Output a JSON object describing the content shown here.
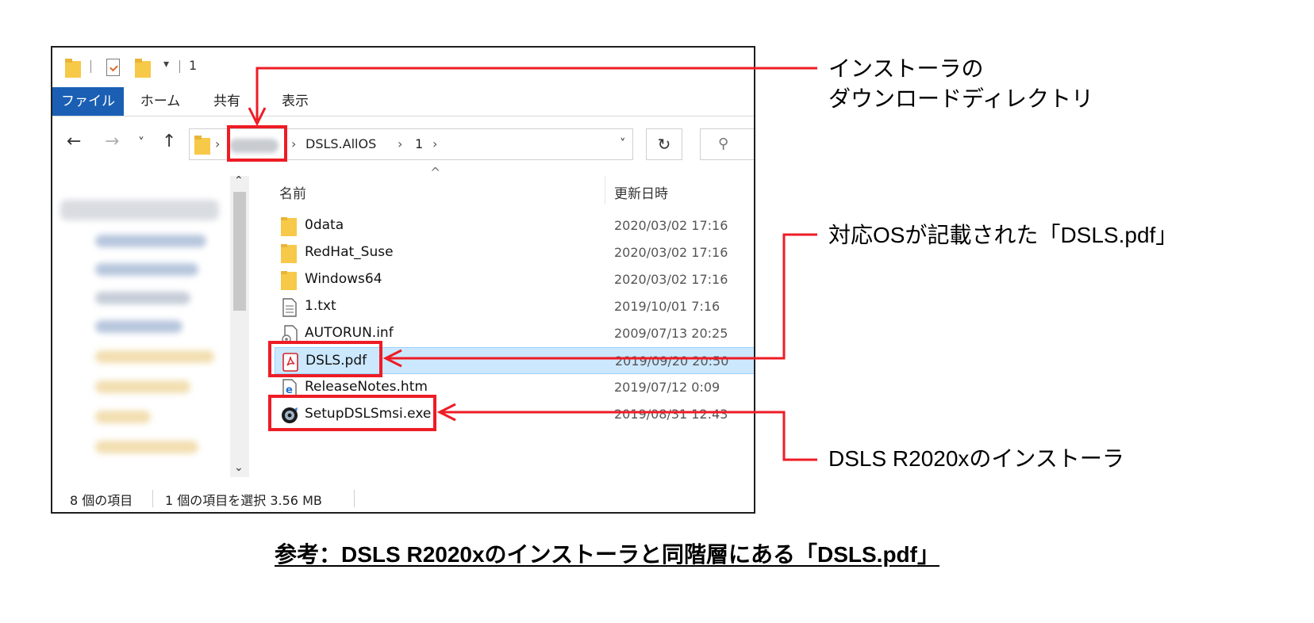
{
  "qat": {
    "title": "1",
    "dropdown": "▾"
  },
  "ribbon": {
    "tabs": [
      "ファイル",
      "ホーム",
      "共有",
      "表示"
    ]
  },
  "nav": {
    "back": "←",
    "forward": "→",
    "recent": "˅",
    "up": "↑"
  },
  "address": {
    "crumbs": [
      "DSLS.AllOS",
      "1"
    ],
    "separator": "›",
    "dropdown": "˅",
    "refresh": "↻",
    "search_icon": "⚲"
  },
  "columns": {
    "name": "名前",
    "date": "更新日時"
  },
  "files": [
    {
      "icon": "folder-icon",
      "name": "0data",
      "date": "2020/03/02 17:16"
    },
    {
      "icon": "folder-icon",
      "name": "RedHat_Suse",
      "date": "2020/03/02 17:16"
    },
    {
      "icon": "folder-icon",
      "name": "Windows64",
      "date": "2020/03/02 17:16"
    },
    {
      "icon": "text-file-icon",
      "name": "1.txt",
      "date": "2019/10/01 7:16"
    },
    {
      "icon": "settings-file-icon",
      "name": "AUTORUN.inf",
      "date": "2009/07/13 20:25"
    },
    {
      "icon": "pdf-icon",
      "name": "DSLS.pdf",
      "date": "2019/09/20 20:50",
      "selected": true
    },
    {
      "icon": "html-file-icon",
      "name": "ReleaseNotes.htm",
      "date": "2019/07/12 0:09"
    },
    {
      "icon": "installer-icon",
      "name": "SetupDSLSmsi.exe",
      "date": "2019/08/31 12:43"
    }
  ],
  "status": {
    "count": "8 個の項目",
    "selection": "1 個の項目を選択  3.56 MB"
  },
  "annotations": {
    "download_dir_line1": "インストーラの",
    "download_dir_line2": "ダウンロードディレクトリ",
    "pdf_label": "対応OSが記載された「DSLS.pdf」",
    "installer_label": "DSLS R2020xのインストーラ"
  },
  "caption": "参考：DSLS R2020xのインストーラと同階層にある「DSLS.pdf」",
  "colors": {
    "annotation_red": "#ee1c25",
    "selection_bg": "#cce8ff",
    "file_tab": "#1a5fb4",
    "folder": "#f7c948"
  }
}
